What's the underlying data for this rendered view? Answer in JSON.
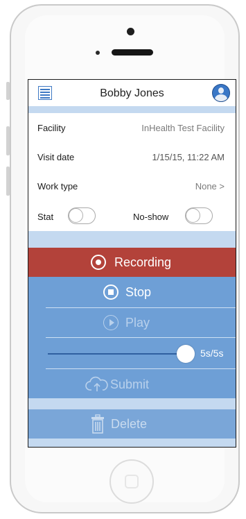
{
  "header": {
    "title": "Bobby Jones",
    "menu_icon": "list-icon",
    "avatar_icon": "user-avatar-icon"
  },
  "form": {
    "facility": {
      "label": "Facility",
      "value": "InHealth Test Facility"
    },
    "visit_date": {
      "label": "Visit date",
      "value": "1/15/15,  11:22 AM"
    },
    "work_type": {
      "label": "Work type",
      "value": "None >"
    },
    "stat": {
      "label": "Stat",
      "on": false
    },
    "no_show": {
      "label": "No-show",
      "on": false
    }
  },
  "recorder": {
    "recording_label": "Recording",
    "stop_label": "Stop",
    "play_label": "Play",
    "progress_label": "5s/5s",
    "progress_fraction": 1.0,
    "submit_label": "Submit",
    "delete_label": "Delete"
  },
  "colors": {
    "accent_blue": "#3e79c4",
    "recording_red": "#b3423a",
    "panel_blue": "#6e9fd6",
    "band_blue": "#c4d9f0"
  }
}
